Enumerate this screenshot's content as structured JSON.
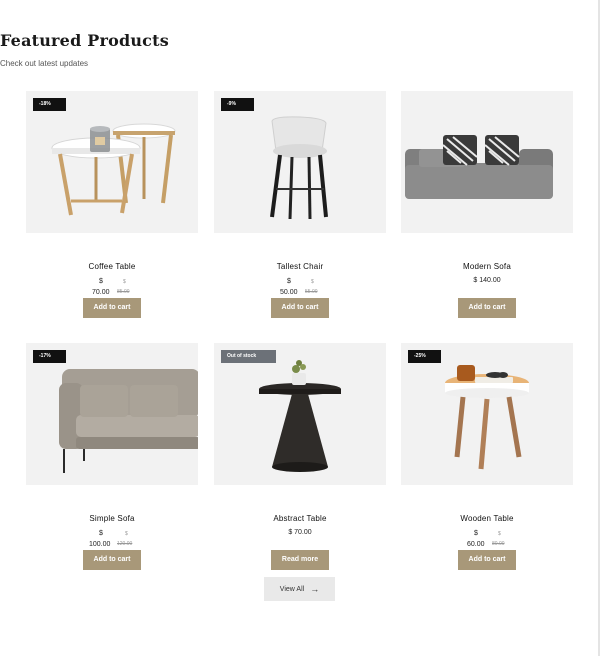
{
  "section": {
    "title": "Featured Products",
    "subtitle": "Check out latest updates"
  },
  "products": [
    {
      "name": "Coffee Table",
      "badge": "-18%",
      "currency": "$",
      "price": "70.00",
      "old_currency": "$",
      "old_price": "85.00",
      "button": "Add to cart"
    },
    {
      "name": "Tallest Chair",
      "badge": "-9%",
      "currency": "$",
      "price": "50.00",
      "old_currency": "$",
      "old_price": "55.00",
      "button": "Add to cart"
    },
    {
      "name": "Modern Sofa",
      "price_text": "$ 140.00",
      "button": "Add to cart"
    },
    {
      "name": "Simple Sofa",
      "badge": "-17%",
      "currency": "$",
      "price": "100.00",
      "old_currency": "$",
      "old_price": "120.00",
      "button": "Add to cart"
    },
    {
      "name": "Abstract Table",
      "badge": "Out of stock",
      "price_text": "$ 70.00",
      "button": "Read more"
    },
    {
      "name": "Wooden Table",
      "badge": "-25%",
      "currency": "$",
      "price": "60.00",
      "old_currency": "$",
      "old_price": "80.00",
      "button": "Add to cart"
    }
  ],
  "view_all": {
    "label": "View All"
  },
  "colors": {
    "accent": "#a89879",
    "badge": "#111111",
    "badge_muted": "#6c7178",
    "thumb_bg": "#f2f2f2"
  },
  "icons": {
    "view_all": "arrow-right-icon"
  }
}
